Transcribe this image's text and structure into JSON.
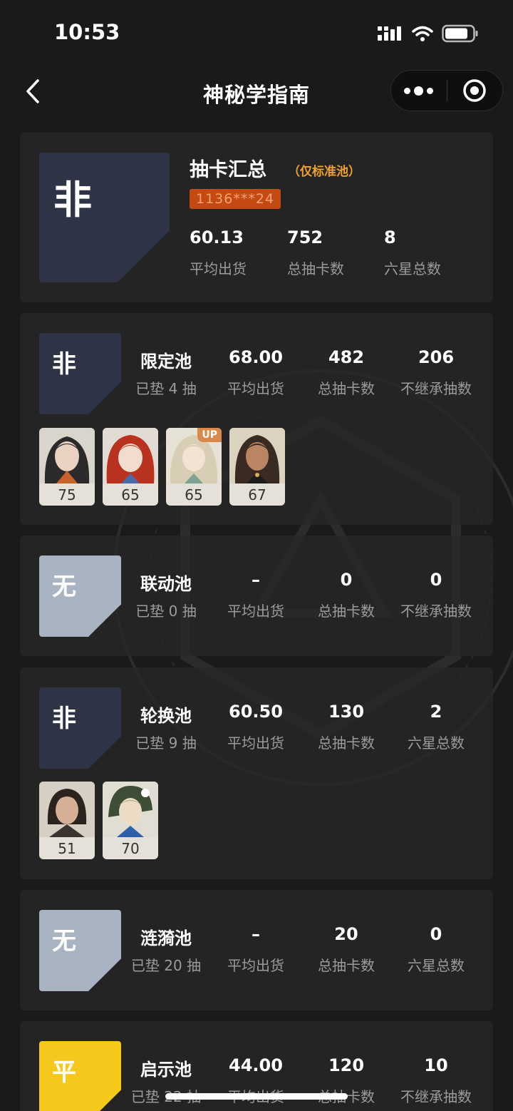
{
  "status": {
    "time": "10:53"
  },
  "nav": {
    "title": "神秘学指南"
  },
  "summary": {
    "badge": "非",
    "title": "抽卡汇总",
    "note": "（仅标准池）",
    "uid": "1136***24",
    "stats": [
      {
        "value": "60.13",
        "label": "平均出货"
      },
      {
        "value": "752",
        "label": "总抽卡数"
      },
      {
        "value": "8",
        "label": "六星总数"
      }
    ]
  },
  "pools": [
    {
      "badge": "非",
      "badge_style": "dark",
      "name": "限定池",
      "pity": "已垫 4 抽",
      "stats": [
        {
          "value": "68.00",
          "label": "平均出货"
        },
        {
          "value": "482",
          "label": "总抽卡数"
        },
        {
          "value": "206",
          "label": "不继承抽数"
        }
      ],
      "chars": [
        {
          "pulls": "75",
          "up": ""
        },
        {
          "pulls": "65",
          "up": ""
        },
        {
          "pulls": "65",
          "up": "UP"
        },
        {
          "pulls": "67",
          "up": ""
        }
      ]
    },
    {
      "badge": "无",
      "badge_style": "light",
      "name": "联动池",
      "pity": "已垫 0 抽",
      "stats": [
        {
          "value": "–",
          "label": "平均出货"
        },
        {
          "value": "0",
          "label": "总抽卡数"
        },
        {
          "value": "0",
          "label": "不继承抽数"
        }
      ],
      "chars": []
    },
    {
      "badge": "非",
      "badge_style": "dark",
      "name": "轮换池",
      "pity": "已垫 9 抽",
      "stats": [
        {
          "value": "60.50",
          "label": "平均出货"
        },
        {
          "value": "130",
          "label": "总抽卡数"
        },
        {
          "value": "2",
          "label": "六星总数"
        }
      ],
      "chars": [
        {
          "pulls": "51",
          "up": ""
        },
        {
          "pulls": "70",
          "up": ""
        }
      ]
    },
    {
      "badge": "无",
      "badge_style": "light",
      "name": "涟漪池",
      "pity": "已垫 20 抽",
      "stats": [
        {
          "value": "–",
          "label": "平均出货"
        },
        {
          "value": "20",
          "label": "总抽卡数"
        },
        {
          "value": "0",
          "label": "六星总数"
        }
      ],
      "chars": []
    },
    {
      "badge": "平",
      "badge_style": "yellow",
      "name": "启示池",
      "pity": "已垫 22 抽",
      "stats": [
        {
          "value": "44.00",
          "label": "平均出货"
        },
        {
          "value": "120",
          "label": "总抽卡数"
        },
        {
          "value": "10",
          "label": "不继承抽数"
        }
      ],
      "chars": []
    }
  ],
  "colors": {
    "badge_dark": "#2e3345",
    "badge_light": "#a9b4c2",
    "badge_yellow": "#f7c81c",
    "accent": "#f0a12b",
    "uid_tag": "#c54a12"
  }
}
